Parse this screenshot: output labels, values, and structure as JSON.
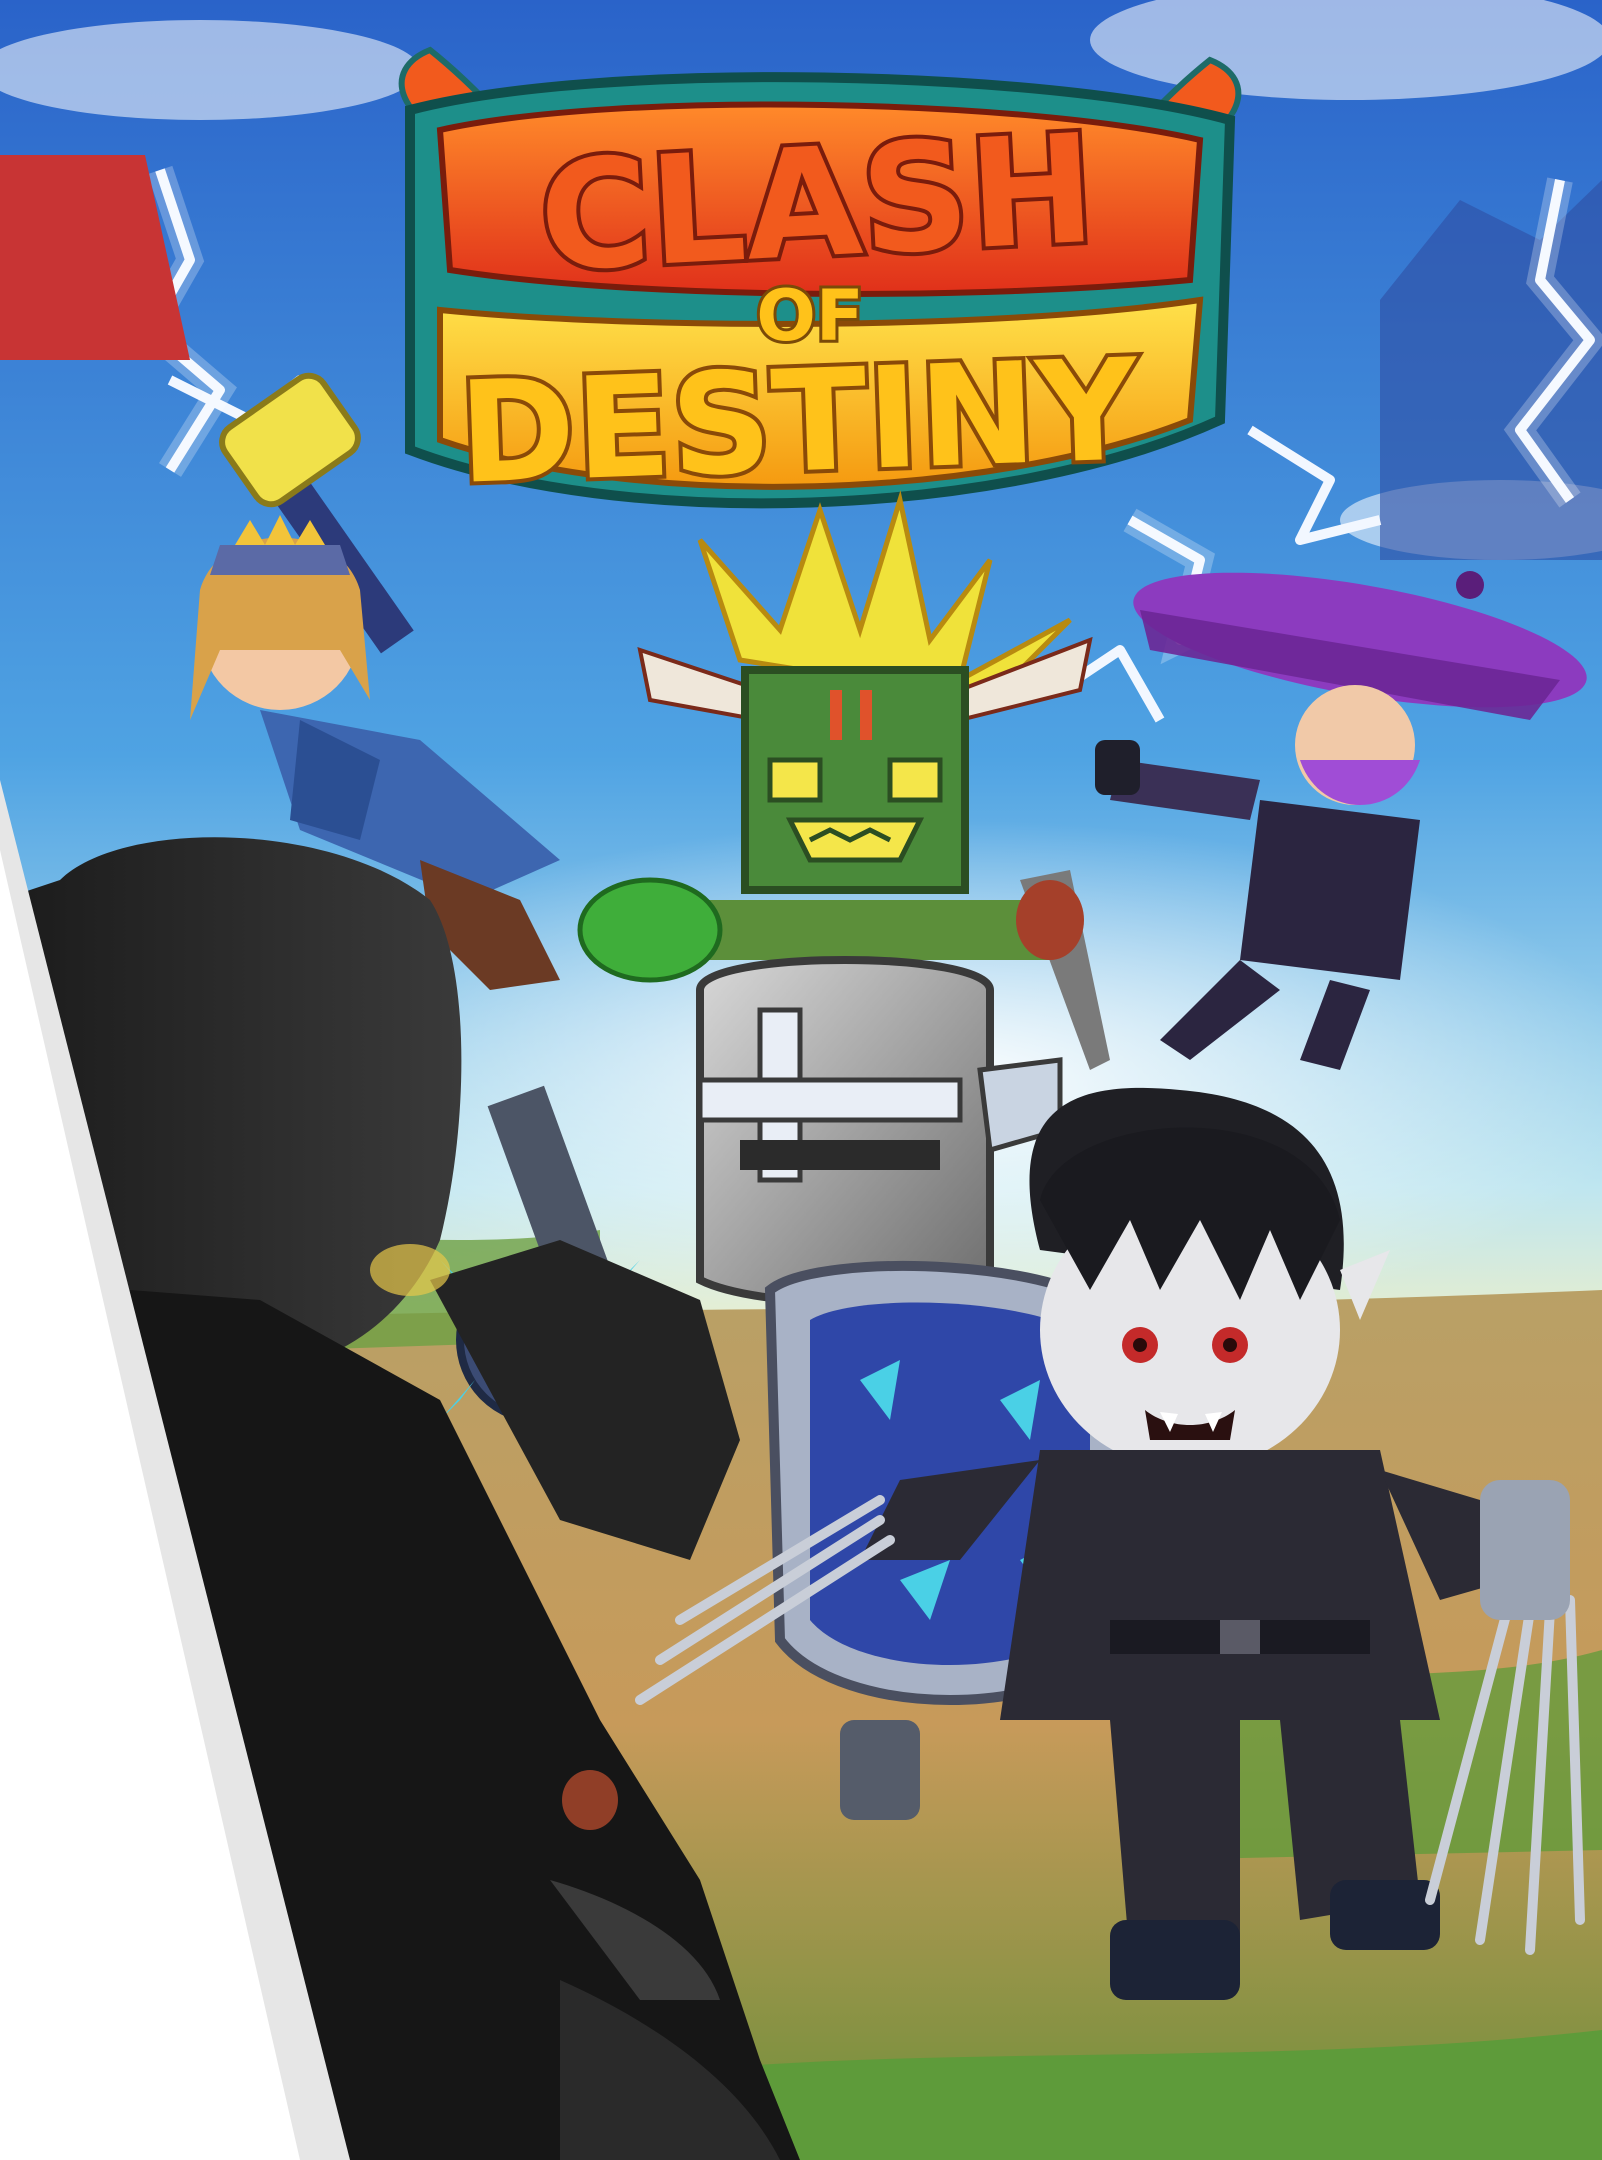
{
  "game": {
    "logo_line1": "CLASH",
    "logo_line2": "OF",
    "logo_line3": "DESTINY"
  },
  "colors": {
    "sky_top": "#2a63c9",
    "sky_mid": "#4fa3e3",
    "horizon": "#f7f1c0",
    "ground": "#c79a5a",
    "grass": "#5e9b3a",
    "lightning": "#f2f7ff",
    "logo_orange": "#f25a1d",
    "logo_yellow": "#ffc21a",
    "logo_teal": "#1d8f8a",
    "panel_white": "#ffffff",
    "panel_gray": "#e6e6e6",
    "tab_red": "#c83434"
  },
  "characters": [
    {
      "name": "princess-warrior",
      "icon": "hammer-icon"
    },
    {
      "name": "tiki-shaman",
      "icon": "mask-icon"
    },
    {
      "name": "ninja",
      "icon": "umbrella-hat-icon"
    },
    {
      "name": "knight",
      "icon": "helmet-icon"
    },
    {
      "name": "vampire",
      "icon": "claw-icon"
    },
    {
      "name": "werewolf-silhouette",
      "icon": "wolf-icon"
    }
  ]
}
